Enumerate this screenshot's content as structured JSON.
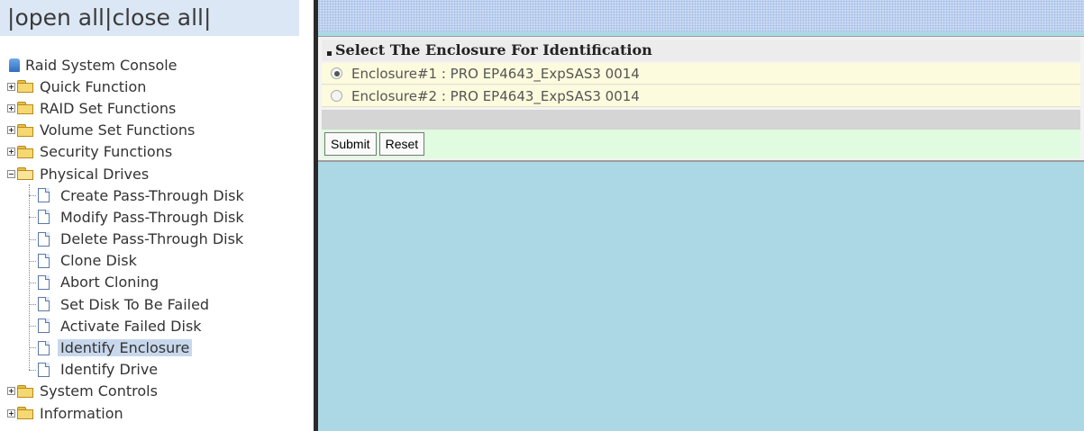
{
  "topbar": {
    "open_all": "open all",
    "close_all": "close all",
    "sep": "|"
  },
  "tree": {
    "root": "Raid System Console",
    "folders": [
      {
        "label": "Quick Function",
        "expanded": false
      },
      {
        "label": "RAID Set Functions",
        "expanded": false
      },
      {
        "label": "Volume Set Functions",
        "expanded": false
      },
      {
        "label": "Security Functions",
        "expanded": false
      },
      {
        "label": "Physical Drives",
        "expanded": true
      },
      {
        "label": "System Controls",
        "expanded": false
      },
      {
        "label": "Information",
        "expanded": false
      }
    ],
    "physical_drives_items": [
      "Create Pass-Through Disk",
      "Modify Pass-Through Disk",
      "Delete Pass-Through Disk",
      "Clone Disk",
      "Abort Cloning",
      "Set Disk To Be Failed",
      "Activate Failed Disk",
      "Identify Enclosure",
      "Identify Drive"
    ],
    "selected_item": "Identify Enclosure"
  },
  "panel": {
    "title": "Select The Enclosure For Identification",
    "options": [
      {
        "label": "Enclosure#1 : PRO EP4643_ExpSAS3 0014",
        "checked": true
      },
      {
        "label": "Enclosure#2 : PRO EP4643_ExpSAS3 0014",
        "checked": false
      }
    ],
    "submit_label": "Submit",
    "reset_label": "Reset"
  }
}
